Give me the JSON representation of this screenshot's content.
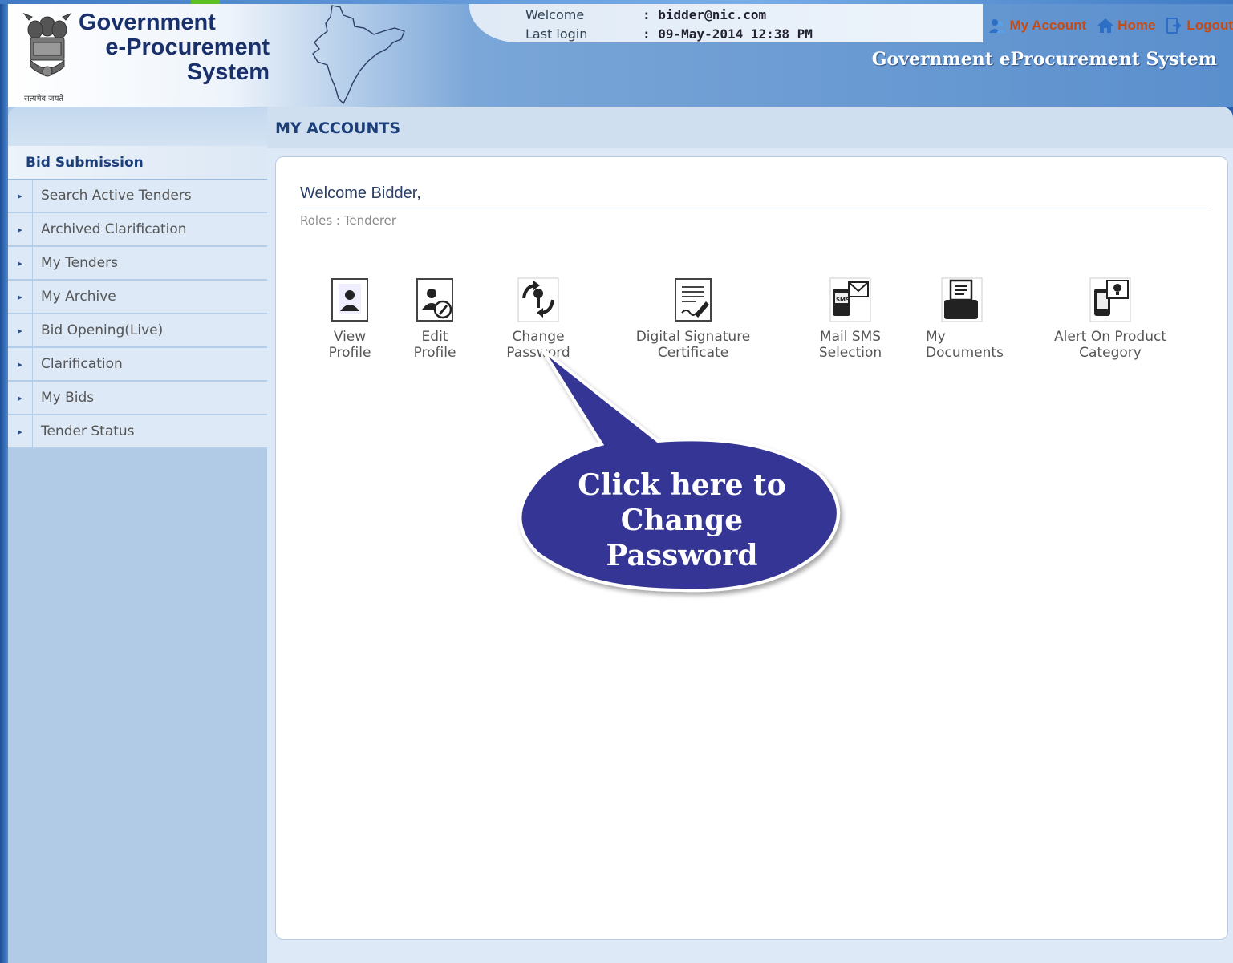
{
  "header": {
    "brand_line1": "Government",
    "brand_line2": "e-Procurement",
    "brand_line3": "System",
    "emblem_caption": "सत्यमेव जयते",
    "welcome_label": "Welcome",
    "welcome_value": ": bidder@nic.com",
    "last_login_label": "Last login",
    "last_login_value": ": 09-May-2014 12:38 PM",
    "links": {
      "my_account": "My Account",
      "home": "Home",
      "logout": "Logout"
    },
    "system_title": "Government eProcurement System"
  },
  "sidebar": {
    "heading": "Bid Submission",
    "items": [
      {
        "label": "Search Active Tenders"
      },
      {
        "label": "Archived Clarification"
      },
      {
        "label": "My Tenders"
      },
      {
        "label": "My Archive"
      },
      {
        "label": "Bid Opening(Live)"
      },
      {
        "label": "Clarification"
      },
      {
        "label": "My Bids"
      },
      {
        "label": "Tender Status"
      }
    ]
  },
  "main": {
    "title": "MY ACCOUNTS",
    "welcome": "Welcome Bidder,",
    "roles": "Roles : Tenderer",
    "tiles": [
      {
        "line1": "View",
        "line2": "Profile",
        "icon": "view-profile-icon"
      },
      {
        "line1": "Edit",
        "line2": "Profile",
        "icon": "edit-profile-icon"
      },
      {
        "line1": "Change",
        "line2": "Password",
        "icon": "change-password-icon"
      },
      {
        "line1": "Digital Signature",
        "line2": "Certificate",
        "icon": "digital-signature-icon"
      },
      {
        "line1": "Mail SMS",
        "line2": "Selection",
        "icon": "mail-sms-icon"
      },
      {
        "line1": "My",
        "line2": "Documents",
        "icon": "documents-icon"
      },
      {
        "line1": "Alert On Product",
        "line2": "Category",
        "icon": "alert-product-icon"
      }
    ]
  },
  "callout": {
    "line1": "Click here to",
    "line2": "Change",
    "line3": "Password"
  },
  "colors": {
    "brand_navy": "#19306a",
    "link_orange": "#c84a12",
    "callout_fill": "#353595"
  }
}
